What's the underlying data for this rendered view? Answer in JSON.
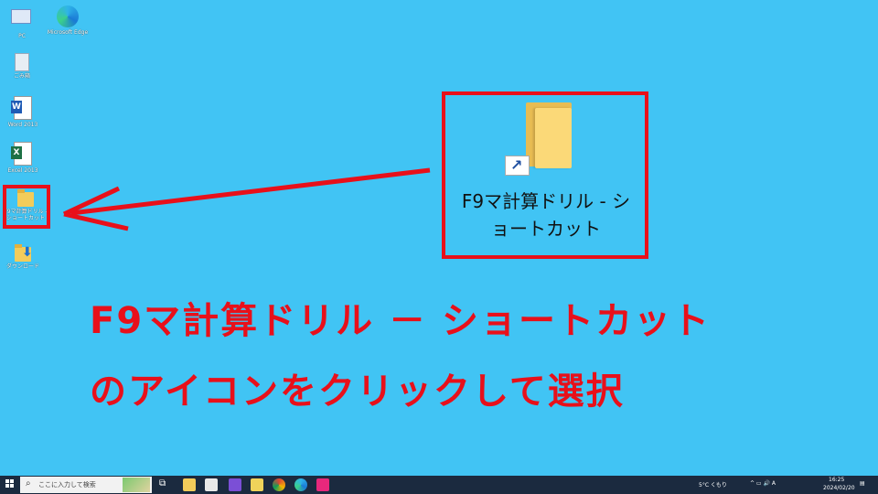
{
  "desktop": {
    "icons": [
      {
        "label": "PC",
        "icon": "pc-icon"
      },
      {
        "label": "Microsoft Edge",
        "icon": "edge-icon"
      },
      {
        "label": "ごみ箱",
        "icon": "recycle-bin-icon"
      },
      {
        "label": "Word 2013",
        "icon": "word-icon"
      },
      {
        "label": "Excel 2013",
        "icon": "excel-icon"
      },
      {
        "label": "F9マ計算ドリル - ショートカット",
        "icon": "folder-shortcut-icon"
      },
      {
        "label": "ダウンロード",
        "icon": "download-folder-icon"
      }
    ]
  },
  "callout": {
    "label_line1": "F9マ計算ドリル - シ",
    "label_line2": "ョートカット",
    "icon": "folder-shortcut-icon",
    "highlight_color": "#e8101a"
  },
  "instruction": {
    "line1": "F9マ計算ドリル － ショートカット",
    "line2": "のアイコンをクリックして選択"
  },
  "taskbar": {
    "search_placeholder": "ここに入力して検索",
    "weather": "5°C  くもり",
    "time": "16:25",
    "date": "2024/02/20"
  },
  "colors": {
    "desktop_bg": "#41c4f4",
    "taskbar_bg": "#1b2a3f",
    "accent_red": "#e8101a"
  }
}
